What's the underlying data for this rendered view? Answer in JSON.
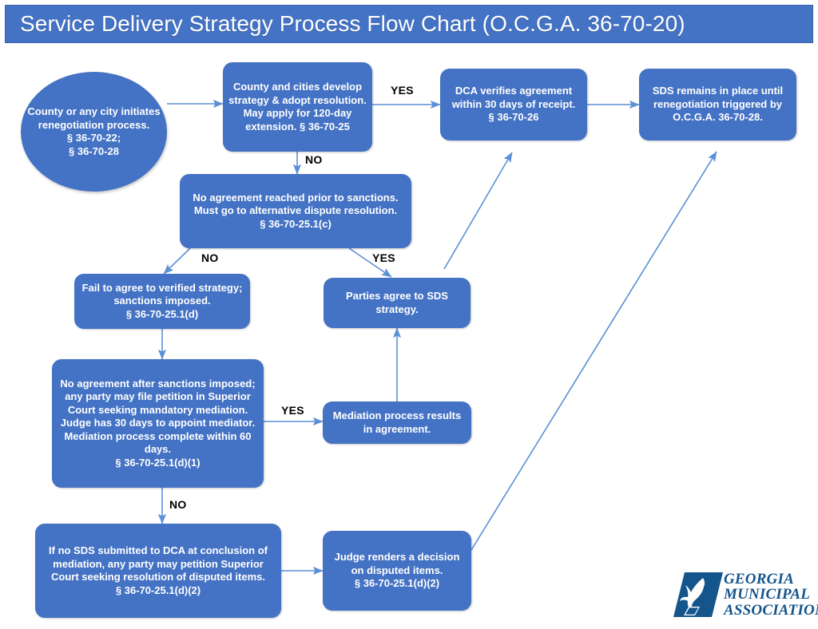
{
  "header": {
    "title": "Service Delivery Strategy Process Flow Chart (O.C.G.A. 36-70-20)",
    "banner_color": "#4472C4",
    "title_color": "#FFFFFF"
  },
  "theme": {
    "node_fill": "#4472C4",
    "node_text": "#FFFFFF",
    "connector_color": "#5B8FD6",
    "edge_label_color": "#000000",
    "page_background": "#FFFFFF",
    "logo_color": "#14558C"
  },
  "chart_data": {
    "type": "diagram",
    "title": "Service Delivery Strategy Process Flow Chart (O.C.G.A. 36-70-20)",
    "nodes": [
      {
        "id": "start",
        "shape": "circle",
        "text": "County or any city initiates renegotiation process.\n§ 36-70-22;\n§ 36-70-28"
      },
      {
        "id": "develop",
        "shape": "rounded-rect",
        "text": "County and cities develop strategy & adopt resolution. May apply for 120-day extension. § 36-70-25"
      },
      {
        "id": "dca-verifies",
        "shape": "rounded-rect",
        "text": "DCA verifies agreement within 30 days of receipt.\n§ 36-70-26"
      },
      {
        "id": "sds-remains",
        "shape": "rounded-rect",
        "text": "SDS remains in place until renegotiation triggered by O.C.G.A. 36-70-28."
      },
      {
        "id": "no-agreement-sanctions",
        "shape": "rounded-rect",
        "text": "No agreement reached prior to sanctions. Must go to alternative dispute resolution.\n§ 36-70-25.1(c)"
      },
      {
        "id": "fail-to-agree",
        "shape": "rounded-rect",
        "text": "Fail to agree to verified strategy; sanctions imposed.\n§ 36-70-25.1(d)"
      },
      {
        "id": "parties-agree",
        "shape": "rounded-rect",
        "text": "Parties agree to SDS strategy."
      },
      {
        "id": "petition-mediation",
        "shape": "rounded-rect",
        "text": "No agreement after sanctions imposed; any party may file petition in Superior Court seeking mandatory mediation. Judge has 30 days to appoint mediator. Mediation process complete within 60 days.\n§ 36-70-25.1(d)(1)"
      },
      {
        "id": "mediation-agreement",
        "shape": "rounded-rect",
        "text": "Mediation process results in agreement."
      },
      {
        "id": "no-sds-submitted",
        "shape": "rounded-rect",
        "text": "If no SDS submitted to DCA at conclusion of mediation, any party may petition Superior Court seeking resolution of disputed items.\n§ 36-70-25.1(d)(2)"
      },
      {
        "id": "judge-renders",
        "shape": "rounded-rect",
        "text": "Judge renders a decision on disputed items.\n§ 36-70-25.1(d)(2)"
      }
    ],
    "edges": [
      {
        "from": "start",
        "to": "develop",
        "label": ""
      },
      {
        "from": "develop",
        "to": "dca-verifies",
        "label": "YES"
      },
      {
        "from": "dca-verifies",
        "to": "sds-remains",
        "label": ""
      },
      {
        "from": "develop",
        "to": "no-agreement-sanctions",
        "label": "NO"
      },
      {
        "from": "no-agreement-sanctions",
        "to": "fail-to-agree",
        "label": "NO"
      },
      {
        "from": "no-agreement-sanctions",
        "to": "parties-agree",
        "label": "YES"
      },
      {
        "from": "parties-agree",
        "to": "dca-verifies",
        "label": ""
      },
      {
        "from": "fail-to-agree",
        "to": "petition-mediation",
        "label": ""
      },
      {
        "from": "petition-mediation",
        "to": "mediation-agreement",
        "label": "YES"
      },
      {
        "from": "mediation-agreement",
        "to": "parties-agree",
        "label": ""
      },
      {
        "from": "petition-mediation",
        "to": "no-sds-submitted",
        "label": "NO"
      },
      {
        "from": "no-sds-submitted",
        "to": "judge-renders",
        "label": ""
      },
      {
        "from": "judge-renders",
        "to": "sds-remains",
        "label": ""
      }
    ],
    "edge_labels": [
      {
        "id": "yes-develop-dca",
        "text": "YES"
      },
      {
        "id": "no-develop-sanctions",
        "text": "NO"
      },
      {
        "id": "no-sanctions-fail",
        "text": "NO"
      },
      {
        "id": "yes-sanctions-parties",
        "text": "YES"
      },
      {
        "id": "yes-petition-mediation",
        "text": "YES"
      },
      {
        "id": "no-petition-nosds",
        "text": "NO"
      }
    ]
  },
  "logo": {
    "line1": "GEORGIA",
    "line2": "MUNICIPAL",
    "line3": "ASSOCIATION",
    "mark_name": "flame-torch-mark"
  }
}
